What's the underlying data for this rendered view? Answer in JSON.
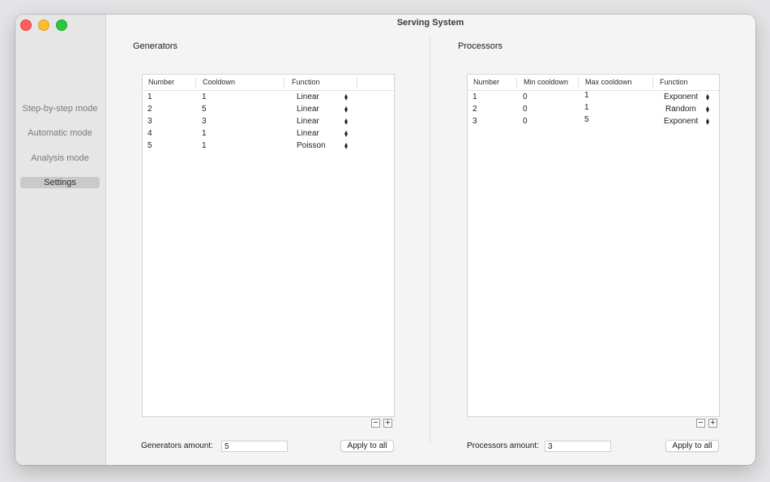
{
  "window": {
    "title": "Serving System"
  },
  "sidebar": {
    "items": [
      {
        "label": "Step-by-step mode"
      },
      {
        "label": "Automatic mode"
      },
      {
        "label": "Analysis mode"
      },
      {
        "label": "Settings",
        "active": true
      }
    ]
  },
  "generators": {
    "title": "Generators",
    "headers": [
      "Number",
      "Cooldown",
      "Function"
    ],
    "rows": [
      {
        "number": "1",
        "cooldown": "1",
        "function": "Linear"
      },
      {
        "number": "2",
        "cooldown": "5",
        "function": "Linear"
      },
      {
        "number": "3",
        "cooldown": "3",
        "function": "Linear"
      },
      {
        "number": "4",
        "cooldown": "1",
        "function": "Linear"
      },
      {
        "number": "5",
        "cooldown": "1",
        "function": "Poisson"
      }
    ],
    "remove_icon": "−",
    "add_icon": "+",
    "amount_label": "Generators amount:",
    "amount_value": "5",
    "apply_label": "Apply to all"
  },
  "processors": {
    "title": "Processors",
    "headers": [
      "Number",
      "Min cooldown",
      "Max cooldown",
      "Function"
    ],
    "rows": [
      {
        "number": "1",
        "min": "0",
        "max": "1",
        "function": "Exponent"
      },
      {
        "number": "2",
        "min": "0",
        "max": "1",
        "function": "Random"
      },
      {
        "number": "3",
        "min": "0",
        "max": "5",
        "function": "Exponent"
      }
    ],
    "remove_icon": "−",
    "add_icon": "+",
    "amount_label": "Processors amount:",
    "amount_value": "3",
    "apply_label": "Apply to all"
  },
  "icons": {
    "updown": "updown-chevron-icon"
  }
}
